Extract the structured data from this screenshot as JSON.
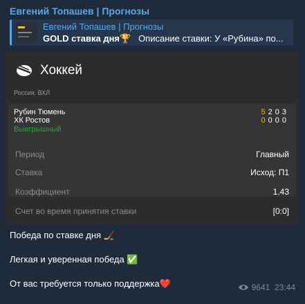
{
  "channel": {
    "name": "Евгений Топашев | Прогнозы"
  },
  "reply": {
    "title": "Евгений Топашев | Прогнозы",
    "bold_text": "GOLD ставка дня🏆",
    "text": "Описание ставки: У «Рубина» по..."
  },
  "card": {
    "sport": "Хоккей",
    "league": "Россия. ВХЛ",
    "team1": "Рубин Тюмень",
    "team2": "ХК Ростов",
    "scores1": [
      "5",
      "2",
      "0",
      "3"
    ],
    "scores2": [
      "0",
      "0",
      "0",
      "0"
    ],
    "result": "Выигрышный",
    "details": [
      {
        "label": "Период",
        "value": "Главный"
      },
      {
        "label": "Ставка",
        "value": "Исход: П1"
      },
      {
        "label": "Коэффициент",
        "value": "1.43"
      },
      {
        "label": "Счет во время принятия ставки",
        "value": "[0:0]"
      }
    ]
  },
  "message": {
    "line1": "Победа по ставке дня 🏒",
    "line2": "Легкая и уверенная победа ✅",
    "line3": "От вас требуется только поддержка❤️"
  },
  "meta": {
    "views": "9641",
    "time": "23:44"
  },
  "colors": {
    "accent": "#5aa9e6",
    "win": "#2ea043",
    "highlight": "#e8b62c"
  }
}
